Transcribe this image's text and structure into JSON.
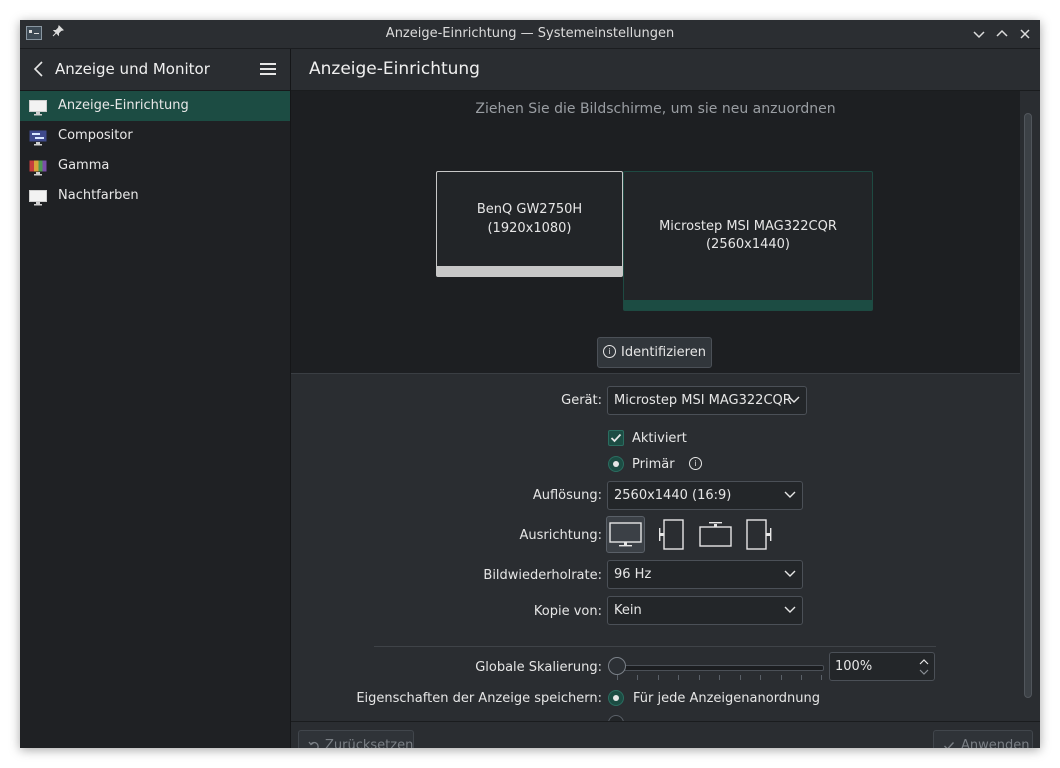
{
  "window": {
    "title": "Anzeige-Einrichtung — Systemeinstellungen"
  },
  "sidebar": {
    "title": "Anzeige und Monitor",
    "items": [
      {
        "label": "Anzeige-Einrichtung",
        "icon": "monitor-icon"
      },
      {
        "label": "Compositor",
        "icon": "compositor-icon"
      },
      {
        "label": "Gamma",
        "icon": "gamma-icon"
      },
      {
        "label": "Nachtfarben",
        "icon": "night-color-icon"
      }
    ]
  },
  "main": {
    "title": "Anzeige-Einrichtung",
    "hint": "Ziehen Sie die Bildschirme, um sie neu anzuordnen",
    "monitors": [
      {
        "name": "BenQ GW2750H",
        "resolution": "(1920x1080)"
      },
      {
        "name": "Microstep MSI MAG322CQR",
        "resolution": "(2560x1440)"
      }
    ],
    "identify_label": "Identifizieren"
  },
  "form": {
    "device_label": "Gerät:",
    "device_value": "Microstep MSI MAG322CQR",
    "enabled_label": "Aktiviert",
    "primary_label": "Primär",
    "resolution_label": "Auflösung:",
    "resolution_value": "2560x1440 (16:9)",
    "orientation_label": "Ausrichtung:",
    "refresh_label": "Bildwiederholrate:",
    "refresh_value": "96 Hz",
    "mirror_label": "Kopie von:",
    "mirror_value": "Kein",
    "scale_label": "Globale Skalierung:",
    "scale_value": "100%",
    "save_label": "Eigenschaften der Anzeige speichern:",
    "save_option_1": "Für jede Anzeigenanordnung"
  },
  "footer": {
    "reset_label": "Zurücksetzen",
    "apply_label": "Anwenden"
  },
  "colors": {
    "accent": "#1c4c43",
    "window_bg": "#2a2d31"
  }
}
